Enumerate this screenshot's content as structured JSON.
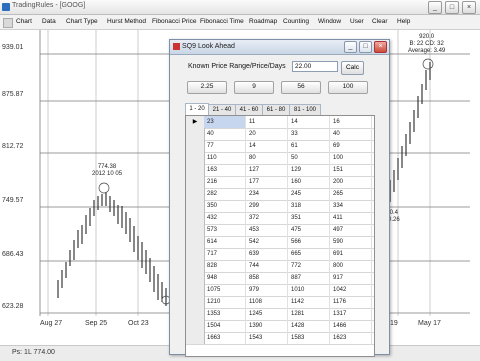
{
  "window": {
    "title": "TradingRules - [GOOG]",
    "controls": [
      "_",
      "□",
      "×"
    ]
  },
  "menu": [
    "Chart",
    "Data",
    "Chart Type",
    "Hurst Method",
    "Fibonacci Price",
    "Fibonacci Time",
    "Roadmap",
    "Counting",
    "Window",
    "User",
    "Clear",
    "Help"
  ],
  "chart": {
    "y_labels": [
      "939.01",
      "875.87",
      "812.72",
      "749.57",
      "686.43",
      "623.28"
    ],
    "x_labels": [
      "Aug 27",
      "Sep 25",
      "Oct 23",
      "19",
      "May 17"
    ],
    "annotations": {
      "low_high": {
        "value": "774.38",
        "date": "2012 10 05"
      },
      "top": {
        "value": "920.0",
        "sub": "B: 22 CD: 32",
        "note": "Average: 3.49"
      },
      "mid": {
        "value": "0.4",
        "date": "0.26"
      }
    }
  },
  "status": {
    "text": "Ps: 1L  774.00"
  },
  "dialog": {
    "title": "SQ9 Look Ahead",
    "field_label": "Known Price Range/Price/Days",
    "field_value": "22.00",
    "calc_label": "Calc",
    "preset_buttons": [
      "2.25",
      "9",
      "56",
      "100"
    ],
    "tabs": [
      "1 - 20",
      "21 - 40",
      "41 - 60",
      "61 - 80",
      "81 - 100"
    ],
    "rows": [
      [
        "23",
        "11",
        "14",
        "16"
      ],
      [
        "40",
        "20",
        "33",
        "40"
      ],
      [
        "77",
        "14",
        "61",
        "69"
      ],
      [
        "110",
        "80",
        "50",
        "100"
      ],
      [
        "163",
        "127",
        "129",
        "151"
      ],
      [
        "216",
        "177",
        "160",
        "200"
      ],
      [
        "282",
        "234",
        "245",
        "265"
      ],
      [
        "350",
        "299",
        "318",
        "334"
      ],
      [
        "432",
        "372",
        "351",
        "411"
      ],
      [
        "573",
        "453",
        "475",
        "497"
      ],
      [
        "614",
        "542",
        "566",
        "590"
      ],
      [
        "717",
        "639",
        "665",
        "691"
      ],
      [
        "828",
        "744",
        "772",
        "800"
      ],
      [
        "948",
        "858",
        "887",
        "917"
      ],
      [
        "1075",
        "979",
        "1010",
        "1042"
      ],
      [
        "1210",
        "1108",
        "1142",
        "1176"
      ],
      [
        "1353",
        "1245",
        "1281",
        "1317"
      ],
      [
        "1504",
        "1390",
        "1428",
        "1466"
      ],
      [
        "1663",
        "1543",
        "1583",
        "1623"
      ]
    ]
  }
}
